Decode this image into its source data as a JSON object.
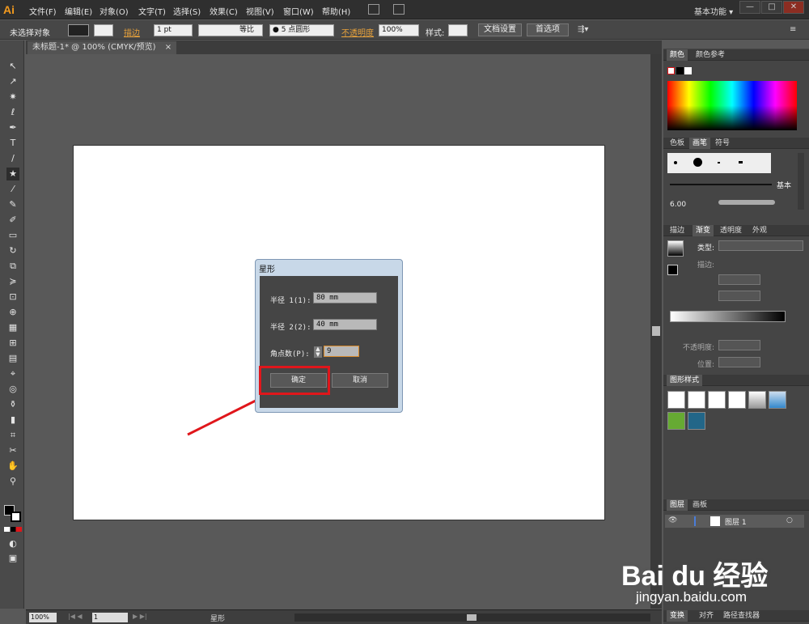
{
  "app": {
    "logo": "Ai",
    "workspace": "基本功能 ▾"
  },
  "menu": [
    "文件(F)",
    "编辑(E)",
    "对象(O)",
    "文字(T)",
    "选择(S)",
    "效果(C)",
    "视图(V)",
    "窗口(W)",
    "帮助(H)"
  ],
  "window_controls": {
    "minimize": "—",
    "restore": "□",
    "close": "✕"
  },
  "control_bar": {
    "selection": "未选择对象",
    "stroke_label": "描边",
    "stroke_weight": "1 pt",
    "stroke_profile": "等比",
    "brush": "●  5 点圆形",
    "opacity_label": "不透明度",
    "opacity_value": "100%",
    "style_label": "样式:",
    "doc_setup": "文档设置",
    "preferences": "首选项"
  },
  "document": {
    "tab_title": "未标题-1* @ 100% (CMYK/预览)"
  },
  "status": {
    "zoom": "100%",
    "page": "1",
    "tool_name": "星形"
  },
  "dialog": {
    "title": "星形",
    "radius1_label": "半径 1(1):",
    "radius1_value": "80 mm",
    "radius2_label": "半径 2(2):",
    "radius2_value": "40 mm",
    "points_label": "角点数(P):",
    "points_value": "9",
    "ok": "确定",
    "cancel": "取消"
  },
  "panels": {
    "color": {
      "tab1": "颜色",
      "tab2": "颜色参考"
    },
    "swatches": {
      "tab1": "色板",
      "tab2": "画笔",
      "tab3": "符号",
      "brush_label": "基本",
      "brush_size": "6.00"
    },
    "gradient": {
      "tab1": "描边",
      "tab2": "渐变",
      "tab3": "透明度",
      "tab4": "外观",
      "type_label": "类型:",
      "stroke_label": "描边:",
      "opacity_label": "不透明度:",
      "location_label": "位置:"
    },
    "graphic_styles": {
      "tab1": "图形样式"
    },
    "layers": {
      "tab1": "图层",
      "tab2": "画板",
      "layer_name": "图层 1"
    },
    "transform": {
      "tab1": "变换",
      "tab2": "对齐",
      "tab3": "路径查找器"
    }
  },
  "watermark": {
    "brand": "Bai du 经验",
    "url": "jingyan.baidu.com"
  },
  "colors": {
    "accent_red": "#e0161b",
    "highlight_orange": "#e8a23b"
  }
}
